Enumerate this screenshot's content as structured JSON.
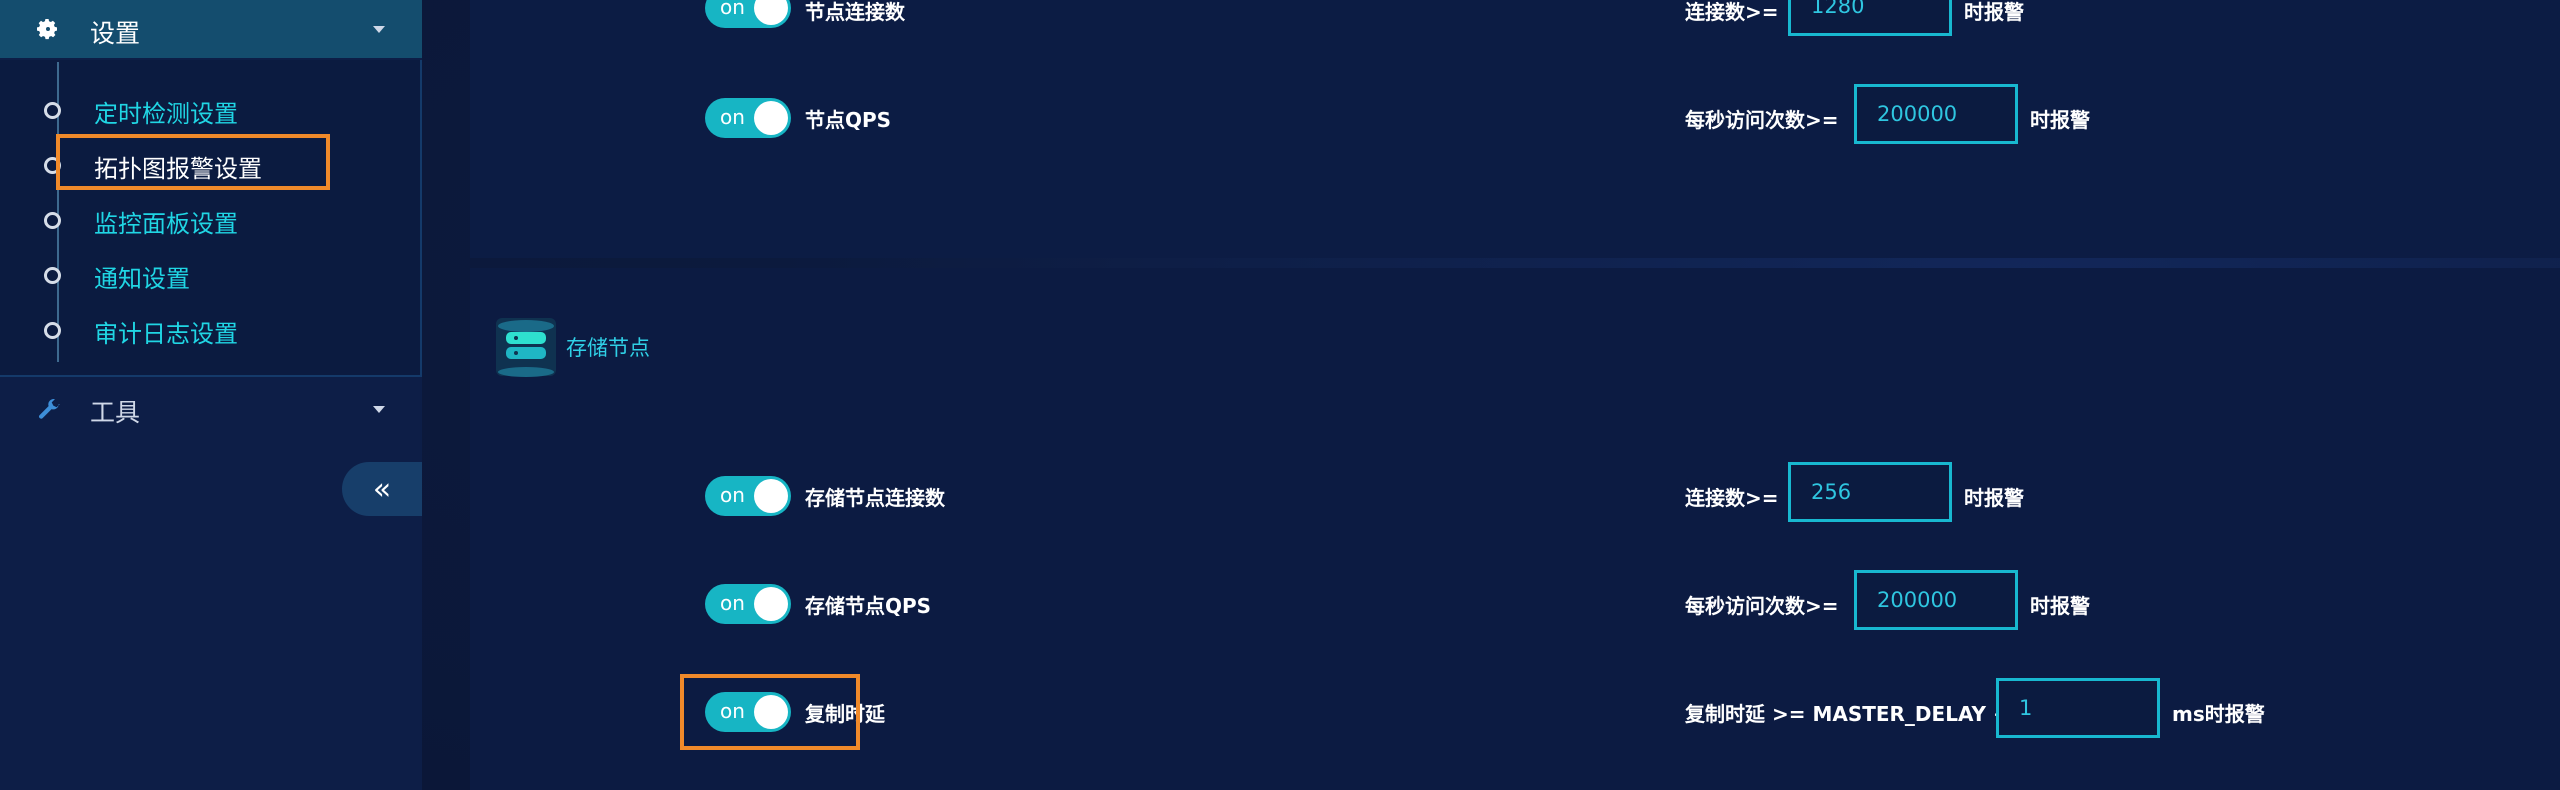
{
  "sidebar": {
    "settings_label": "设置",
    "submenu": [
      {
        "label": "定时检测设置"
      },
      {
        "label": "拓扑图报警设置"
      },
      {
        "label": "监控面板设置"
      },
      {
        "label": "通知设置"
      },
      {
        "label": "审计日志设置"
      }
    ],
    "tools_label": "工具",
    "collapse_symbol": "«"
  },
  "main": {
    "top_rows": [
      {
        "toggle": "on",
        "label": "节点连接数",
        "condition": "连接数>=",
        "value": "1280",
        "suffix": "时报警"
      },
      {
        "toggle": "on",
        "label": "节点QPS",
        "condition": "每秒访问次数>=",
        "value": "200000",
        "suffix": "时报警"
      }
    ],
    "storage_section": {
      "title": "存储节点",
      "rows": [
        {
          "toggle": "on",
          "label": "存储节点连接数",
          "condition": "连接数>=",
          "value": "256",
          "suffix": "时报警"
        },
        {
          "toggle": "on",
          "label": "存储节点QPS",
          "condition": "每秒访问次数>=",
          "value": "200000",
          "suffix": "时报警"
        },
        {
          "toggle": "on",
          "label": "复制时延",
          "condition": "复制时延 >= MASTER_DELAY +",
          "value": "1",
          "suffix": "ms时报警"
        }
      ]
    }
  },
  "colors": {
    "accent": "#17b5c4",
    "highlight": "#f08a2a",
    "sidebar_header": "#144d6e",
    "link_text": "#20d6e4"
  }
}
